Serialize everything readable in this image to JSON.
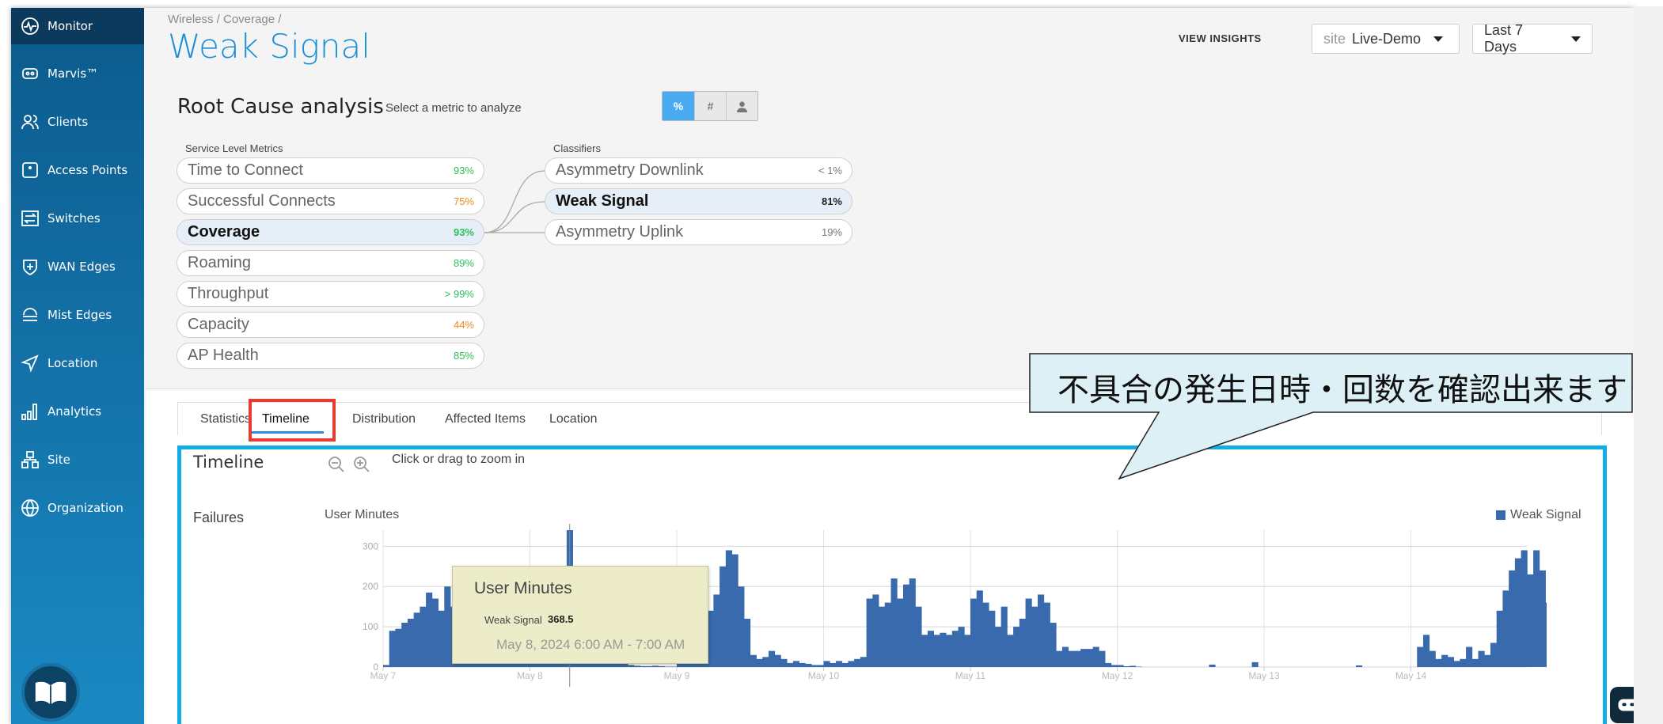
{
  "sidebar": {
    "items": [
      {
        "label": "Monitor",
        "icon": "monitor-icon",
        "active": true
      },
      {
        "label": "Marvis™",
        "icon": "marvis-icon"
      },
      {
        "label": "Clients",
        "icon": "clients-icon"
      },
      {
        "label": "Access Points",
        "icon": "access-points-icon"
      },
      {
        "label": "Switches",
        "icon": "switches-icon"
      },
      {
        "label": "WAN Edges",
        "icon": "wan-edges-icon"
      },
      {
        "label": "Mist Edges",
        "icon": "mist-edges-icon"
      },
      {
        "label": "Location",
        "icon": "location-icon"
      },
      {
        "label": "Analytics",
        "icon": "analytics-icon"
      },
      {
        "label": "Site",
        "icon": "site-icon"
      },
      {
        "label": "Organization",
        "icon": "organization-icon"
      }
    ]
  },
  "header": {
    "breadcrumb": "Wireless / Coverage /",
    "title": "Weak Signal",
    "view_insights": "VIEW INSIGHTS",
    "site_prefix": "site",
    "site_value": "Live-Demo",
    "range_value": "Last 7 Days"
  },
  "rca": {
    "title": "Root Cause analysis",
    "subtitle": "Select a metric to analyze",
    "toggles": [
      "%",
      "#",
      "user-icon"
    ],
    "service_label": "Service Level Metrics",
    "classifier_label": "Classifiers",
    "metrics": [
      {
        "label": "Time to Connect",
        "pct": "93%",
        "color": "#2dbf5a"
      },
      {
        "label": "Successful Connects",
        "pct": "75%",
        "color": "#f08a1c"
      },
      {
        "label": "Coverage",
        "pct": "93%",
        "color": "#2dbf5a",
        "selected": true
      },
      {
        "label": "Roaming",
        "pct": "89%",
        "color": "#2dbf5a"
      },
      {
        "label": "Throughput",
        "pct": "> 99%",
        "color": "#2dbf5a"
      },
      {
        "label": "Capacity",
        "pct": "44%",
        "color": "#f08a1c"
      },
      {
        "label": "AP Health",
        "pct": "85%",
        "color": "#2dbf5a"
      }
    ],
    "classifiers": [
      {
        "label": "Asymmetry Downlink",
        "pct": "< 1%"
      },
      {
        "label": "Weak Signal",
        "pct": "81%",
        "selected": true
      },
      {
        "label": "Asymmetry Uplink",
        "pct": "19%"
      }
    ]
  },
  "tabs": [
    "Statistics",
    "Timeline",
    "Distribution",
    "Affected Items",
    "Location"
  ],
  "timeline": {
    "title": "Timeline",
    "zoom_hint": "Click or drag to zoom in",
    "row_label": "Failures"
  },
  "callout": {
    "text": "不具合の発生日時・回数を確認出来ます"
  },
  "tooltip": {
    "title": "User Minutes",
    "series": "Weak Signal",
    "value": "368.5",
    "date": "May 8, 2024 6:00 AM - 7:00 AM"
  },
  "chart_data": {
    "type": "bar",
    "ylabel": "User Minutes",
    "series_name": "Weak Signal",
    "color": "#3a6aae",
    "ylim": [
      0,
      340
    ],
    "yticks": [
      0,
      100,
      200,
      300
    ],
    "x_tick_labels": [
      "May 7",
      "May 8",
      "May 9",
      "May 10",
      "May 11",
      "May 12",
      "May 13",
      "May 14"
    ],
    "bar_width_hours": 1,
    "start": "May 7, 2024 12:00 AM",
    "values": [
      5,
      90,
      95,
      110,
      120,
      135,
      150,
      185,
      170,
      140,
      200,
      150,
      110,
      95,
      100,
      110,
      120,
      110,
      95,
      60,
      50,
      40,
      30,
      20,
      70,
      60,
      55,
      80,
      100,
      40,
      368.5,
      90,
      60,
      40,
      30,
      25,
      15,
      10,
      10,
      8,
      5,
      3,
      2,
      2,
      3,
      2,
      1,
      1,
      30,
      40,
      100,
      130,
      150,
      140,
      180,
      250,
      290,
      280,
      200,
      120,
      30,
      20,
      25,
      40,
      30,
      20,
      10,
      15,
      10,
      8,
      5,
      5,
      15,
      10,
      15,
      10,
      15,
      20,
      25,
      170,
      180,
      150,
      160,
      220,
      170,
      205,
      220,
      150,
      80,
      90,
      80,
      85,
      80,
      90,
      100,
      80,
      170,
      190,
      160,
      140,
      100,
      150,
      80,
      100,
      120,
      170,
      150,
      180,
      160,
      110,
      40,
      50,
      40,
      40,
      45,
      45,
      50,
      40,
      10,
      5,
      5,
      2,
      3,
      1,
      0,
      0,
      0,
      0,
      0,
      0,
      0,
      0,
      0,
      0,
      0,
      6,
      0,
      0,
      0,
      0,
      0,
      0,
      12,
      0,
      0,
      0,
      0,
      0,
      0,
      0,
      0,
      0,
      0,
      0,
      0,
      0,
      0,
      0,
      0,
      4,
      0,
      0,
      0,
      0,
      0,
      0,
      0,
      0,
      0,
      50,
      80,
      40,
      20,
      30,
      25,
      15,
      20,
      50,
      20,
      40,
      30,
      60,
      140,
      190,
      240,
      270,
      290,
      230,
      290,
      240,
      160,
      150,
      120,
      140,
      60,
      120,
      80
    ]
  }
}
